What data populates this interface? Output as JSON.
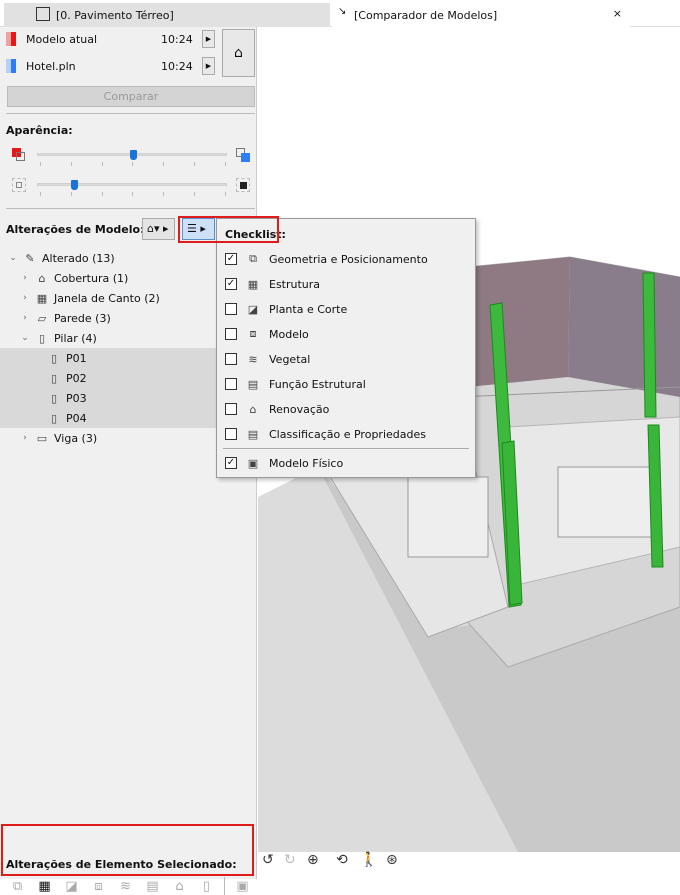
{
  "tabs": [
    {
      "label": "[0. Pavimento Térreo]",
      "icon": "floor-plan-icon"
    },
    {
      "label": "[Comparador de Modelos]",
      "icon": "compare-icon",
      "close": "×"
    }
  ],
  "models": [
    {
      "name": "Modelo atual",
      "time": "10:24",
      "color": "#e8181a"
    },
    {
      "name": "Hotel.pln",
      "time": "10:24",
      "color": "#2f7cf6"
    }
  ],
  "compare_label": "Comparar",
  "appearance_label": "Aparência:",
  "sliders": {
    "opacity": 0.5,
    "detail": 0.18
  },
  "model_changes_label": "Alterações de Modelo:",
  "tree": [
    {
      "label": "Alterado (13)",
      "level": 0,
      "open": true,
      "icon": "pencil-icon"
    },
    {
      "label": "Cobertura (1)",
      "level": 1,
      "icon": "roof-icon"
    },
    {
      "label": "Janela de Canto (2)",
      "level": 1,
      "icon": "corner-window-icon"
    },
    {
      "label": "Parede (3)",
      "level": 1,
      "icon": "wall-icon"
    },
    {
      "label": "Pilar (4)",
      "level": 1,
      "open": true,
      "icon": "column-icon"
    },
    {
      "label": "P01",
      "level": 2,
      "selected": true,
      "icon": "column-icon"
    },
    {
      "label": "P02",
      "level": 2,
      "selected": true,
      "icon": "column-icon"
    },
    {
      "label": "P03",
      "level": 2,
      "selected": true,
      "icon": "column-icon"
    },
    {
      "label": "P04",
      "level": 2,
      "selected": true,
      "icon": "column-icon"
    },
    {
      "label": "Viga (3)",
      "level": 1,
      "icon": "beam-icon"
    }
  ],
  "checklist": {
    "title": "Checklist:",
    "items": [
      {
        "label": "Geometria e Posicionamento",
        "checked": true
      },
      {
        "label": "Estrutura",
        "checked": true
      },
      {
        "label": "Planta e Corte",
        "checked": false
      },
      {
        "label": "Modelo",
        "checked": false
      },
      {
        "label": "Vegetal",
        "checked": false
      },
      {
        "label": "Função Estrutural",
        "checked": false
      },
      {
        "label": "Renovação",
        "checked": false
      },
      {
        "label": "Classificação e Propriedades",
        "checked": false
      },
      {
        "label": "Modelo Físico",
        "checked": true
      }
    ]
  },
  "selected_changes_label": "Alterações de Elemento Selecionado:"
}
